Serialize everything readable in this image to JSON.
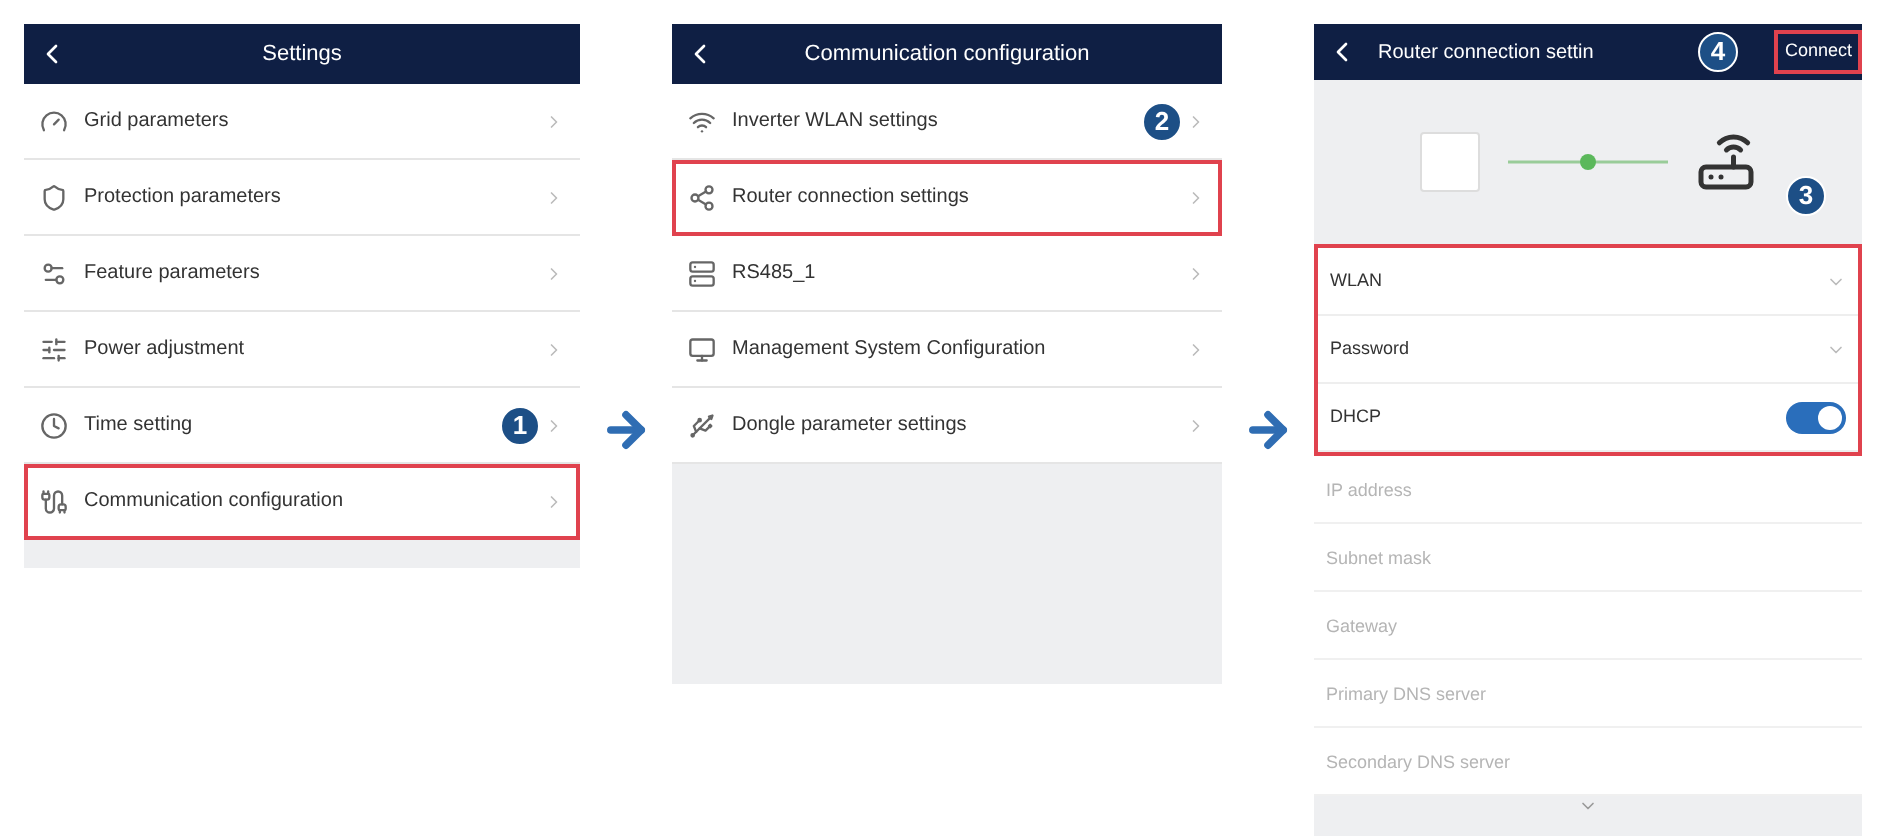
{
  "screens": [
    {
      "title": "Settings",
      "rows": [
        {
          "label": "Grid parameters",
          "highlighted": false
        },
        {
          "label": "Protection parameters",
          "highlighted": false
        },
        {
          "label": "Feature parameters",
          "highlighted": false
        },
        {
          "label": "Power adjustment",
          "highlighted": false
        },
        {
          "label": "Time setting",
          "highlighted": false,
          "badge": "1"
        },
        {
          "label": "Communication configuration",
          "highlighted": true
        }
      ]
    },
    {
      "title": "Communication configuration",
      "rows": [
        {
          "label": "Inverter WLAN settings",
          "highlighted": false,
          "badge": "2"
        },
        {
          "label": "Router connection settings",
          "highlighted": true
        },
        {
          "label": "RS485_1",
          "highlighted": false
        },
        {
          "label": "Management System Configuration",
          "highlighted": false
        },
        {
          "label": "Dongle parameter settings",
          "highlighted": false
        }
      ]
    }
  ],
  "router_screen": {
    "title": "Router connection settin",
    "header_badge": "4",
    "action": {
      "label": "Connect",
      "highlighted": true
    },
    "diagram_badge": "3",
    "group": {
      "highlighted": true,
      "rows": [
        {
          "kind": "dropdown",
          "label": "WLAN"
        },
        {
          "kind": "dropdown",
          "label": "Password"
        },
        {
          "kind": "toggle",
          "label": "DHCP",
          "on": true
        }
      ]
    },
    "fields": [
      {
        "placeholder": "IP address"
      },
      {
        "placeholder": "Subnet mask"
      },
      {
        "placeholder": "Gateway"
      },
      {
        "placeholder": "Primary DNS server"
      },
      {
        "placeholder": "Secondary DNS server"
      }
    ]
  }
}
